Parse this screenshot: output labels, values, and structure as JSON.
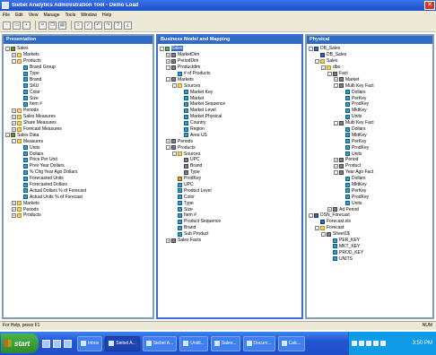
{
  "window": {
    "title": "Siebel Analytics Administration Tool - Demo Load",
    "close_glyph": "✕"
  },
  "menu": [
    "File",
    "Edit",
    "View",
    "Manage",
    "Tools",
    "Window",
    "Help"
  ],
  "toolbar": {
    "icons": [
      "new-icon",
      "open-icon",
      "save-icon",
      "cut-icon",
      "copy-icon",
      "paste-icon",
      "find-icon",
      "check-in-icon",
      "undo-icon",
      "redo-icon",
      "query-icon",
      "help-icon"
    ]
  },
  "panes": {
    "presentation": {
      "title": "Presentation",
      "rows": [
        {
          "d": 0,
          "exp": "-",
          "icon": "presentation",
          "label": "Sales"
        },
        {
          "d": 1,
          "exp": "+",
          "icon": "folder",
          "label": "Markets"
        },
        {
          "d": 1,
          "exp": "-",
          "icon": "folder",
          "label": "Products"
        },
        {
          "d": 2,
          "exp": "",
          "icon": "column",
          "label": "Brand Group"
        },
        {
          "d": 2,
          "exp": "",
          "icon": "column",
          "label": "Type"
        },
        {
          "d": 2,
          "exp": "",
          "icon": "column",
          "label": "Brand"
        },
        {
          "d": 2,
          "exp": "",
          "icon": "column",
          "label": "SKU"
        },
        {
          "d": 2,
          "exp": "",
          "icon": "column",
          "label": "Color"
        },
        {
          "d": 2,
          "exp": "",
          "icon": "column",
          "label": "Size"
        },
        {
          "d": 2,
          "exp": "",
          "icon": "column",
          "label": "Item #"
        },
        {
          "d": 1,
          "exp": "+",
          "icon": "folder",
          "label": "Periods"
        },
        {
          "d": 1,
          "exp": "+",
          "icon": "folder",
          "label": "Sales Measures"
        },
        {
          "d": 1,
          "exp": "+",
          "icon": "folder",
          "label": "Share Measures"
        },
        {
          "d": 1,
          "exp": "+",
          "icon": "folder",
          "label": "Forecast Measures"
        },
        {
          "d": 0,
          "exp": "-",
          "icon": "presentation",
          "label": "Sales Data"
        },
        {
          "d": 1,
          "exp": "-",
          "icon": "folder",
          "label": "Measures"
        },
        {
          "d": 2,
          "exp": "",
          "icon": "column",
          "label": "Units"
        },
        {
          "d": 2,
          "exp": "",
          "icon": "column",
          "label": "Dollars"
        },
        {
          "d": 2,
          "exp": "",
          "icon": "column",
          "label": "Price Per Unit"
        },
        {
          "d": 2,
          "exp": "",
          "icon": "column",
          "label": "Prev Year Dollars"
        },
        {
          "d": 2,
          "exp": "",
          "icon": "column",
          "label": "% Chg Year Ago Dollars"
        },
        {
          "d": 2,
          "exp": "",
          "icon": "column",
          "label": "Forecasted Units"
        },
        {
          "d": 2,
          "exp": "",
          "icon": "column",
          "label": "Forecasted Dollars"
        },
        {
          "d": 2,
          "exp": "",
          "icon": "column",
          "label": "Actual Dollars % of Forecast"
        },
        {
          "d": 2,
          "exp": "",
          "icon": "column",
          "label": "Actual Units % of Forecast"
        },
        {
          "d": 1,
          "exp": "+",
          "icon": "folder",
          "label": "Markets"
        },
        {
          "d": 1,
          "exp": "+",
          "icon": "folder",
          "label": "Periods"
        },
        {
          "d": 1,
          "exp": "+",
          "icon": "folder",
          "label": "Products"
        }
      ]
    },
    "business": {
      "title": "Business Model and Mapping",
      "rows": [
        {
          "d": 0,
          "exp": "-",
          "icon": "cube",
          "label": "Sales",
          "sel": true
        },
        {
          "d": 1,
          "exp": "+",
          "icon": "table",
          "label": "MarketDim"
        },
        {
          "d": 1,
          "exp": "+",
          "icon": "table",
          "label": "PeriodDim"
        },
        {
          "d": 1,
          "exp": "-",
          "icon": "table",
          "label": "Productdim"
        },
        {
          "d": 2,
          "exp": "",
          "icon": "column",
          "label": "# of Products"
        },
        {
          "d": 1,
          "exp": "-",
          "icon": "table",
          "label": "Markets"
        },
        {
          "d": 2,
          "exp": "-",
          "icon": "folder",
          "label": "Sources"
        },
        {
          "d": 3,
          "exp": "",
          "icon": "column",
          "label": "Market Key"
        },
        {
          "d": 3,
          "exp": "",
          "icon": "column",
          "label": "Market"
        },
        {
          "d": 3,
          "exp": "",
          "icon": "column",
          "label": "Market Sequence"
        },
        {
          "d": 3,
          "exp": "",
          "icon": "column",
          "label": "Market Level"
        },
        {
          "d": 3,
          "exp": "",
          "icon": "column",
          "label": "Market Physical"
        },
        {
          "d": 3,
          "exp": "",
          "icon": "column",
          "label": "Country"
        },
        {
          "d": 3,
          "exp": "",
          "icon": "column",
          "label": "Region"
        },
        {
          "d": 3,
          "exp": "",
          "icon": "column",
          "label": "Area US"
        },
        {
          "d": 1,
          "exp": "+",
          "icon": "table",
          "label": "Periods"
        },
        {
          "d": 1,
          "exp": "-",
          "icon": "table",
          "label": "Products"
        },
        {
          "d": 2,
          "exp": "-",
          "icon": "folder",
          "label": "Sources"
        },
        {
          "d": 3,
          "exp": "",
          "icon": "table",
          "label": "UPC"
        },
        {
          "d": 3,
          "exp": "",
          "icon": "table",
          "label": "Brand"
        },
        {
          "d": 3,
          "exp": "",
          "icon": "table",
          "label": "Type"
        },
        {
          "d": 2,
          "exp": "",
          "icon": "key",
          "label": "ProdKey"
        },
        {
          "d": 2,
          "exp": "",
          "icon": "column",
          "label": "UPC"
        },
        {
          "d": 2,
          "exp": "",
          "icon": "column",
          "label": "Product Level"
        },
        {
          "d": 2,
          "exp": "",
          "icon": "column",
          "label": "Color"
        },
        {
          "d": 2,
          "exp": "",
          "icon": "column",
          "label": "Type"
        },
        {
          "d": 2,
          "exp": "",
          "icon": "column",
          "label": "Size"
        },
        {
          "d": 2,
          "exp": "",
          "icon": "column",
          "label": "Item #"
        },
        {
          "d": 2,
          "exp": "",
          "icon": "column",
          "label": "Product Sequence"
        },
        {
          "d": 2,
          "exp": "",
          "icon": "column",
          "label": "Brand"
        },
        {
          "d": 2,
          "exp": "",
          "icon": "column",
          "label": "Sub Product"
        },
        {
          "d": 1,
          "exp": "+",
          "icon": "table",
          "label": "Sales Facts"
        }
      ]
    },
    "physical": {
      "title": "Physical",
      "rows": [
        {
          "d": 0,
          "exp": "-",
          "icon": "db",
          "label": "DB_Sales"
        },
        {
          "d": 1,
          "exp": "",
          "icon": "db",
          "label": "DB_Sales"
        },
        {
          "d": 1,
          "exp": "-",
          "icon": "folder",
          "label": "Sales"
        },
        {
          "d": 2,
          "exp": "-",
          "icon": "folder",
          "label": "dbo"
        },
        {
          "d": 3,
          "exp": "-",
          "icon": "table",
          "label": "Fact"
        },
        {
          "d": 4,
          "exp": "+",
          "icon": "table",
          "label": "Market"
        },
        {
          "d": 4,
          "exp": "-",
          "icon": "table",
          "label": "Multi Key Fact"
        },
        {
          "d": 5,
          "exp": "",
          "icon": "column",
          "label": "Dollars"
        },
        {
          "d": 5,
          "exp": "",
          "icon": "column",
          "label": "PerKey"
        },
        {
          "d": 5,
          "exp": "",
          "icon": "column",
          "label": "ProdKey"
        },
        {
          "d": 5,
          "exp": "",
          "icon": "column",
          "label": "MktKey"
        },
        {
          "d": 5,
          "exp": "",
          "icon": "column",
          "label": "Units"
        },
        {
          "d": 4,
          "exp": "-",
          "icon": "table",
          "label": "Multi Key Fact"
        },
        {
          "d": 5,
          "exp": "",
          "icon": "column",
          "label": "Dollars"
        },
        {
          "d": 5,
          "exp": "",
          "icon": "column",
          "label": "MktKey"
        },
        {
          "d": 5,
          "exp": "",
          "icon": "column",
          "label": "PerKey"
        },
        {
          "d": 5,
          "exp": "",
          "icon": "column",
          "label": "ProdKey"
        },
        {
          "d": 5,
          "exp": "",
          "icon": "column",
          "label": "Units"
        },
        {
          "d": 4,
          "exp": "+",
          "icon": "table",
          "label": "Period"
        },
        {
          "d": 4,
          "exp": "+",
          "icon": "table",
          "label": "Product"
        },
        {
          "d": 4,
          "exp": "-",
          "icon": "table",
          "label": "Year Ago Fact"
        },
        {
          "d": 5,
          "exp": "",
          "icon": "column",
          "label": "Dollars"
        },
        {
          "d": 5,
          "exp": "",
          "icon": "column",
          "label": "MktKey"
        },
        {
          "d": 5,
          "exp": "",
          "icon": "column",
          "label": "PerKey"
        },
        {
          "d": 5,
          "exp": "",
          "icon": "column",
          "label": "ProdKey"
        },
        {
          "d": 5,
          "exp": "",
          "icon": "column",
          "label": "Units"
        },
        {
          "d": 3,
          "exp": "+",
          "icon": "table",
          "label": "Ad Period"
        },
        {
          "d": 0,
          "exp": "-",
          "icon": "db",
          "label": "DSN_Forecast"
        },
        {
          "d": 1,
          "exp": "",
          "icon": "db",
          "label": "Forecast.xls"
        },
        {
          "d": 1,
          "exp": "-",
          "icon": "folder",
          "label": "Forecast"
        },
        {
          "d": 2,
          "exp": "-",
          "icon": "table",
          "label": "Sheet1$"
        },
        {
          "d": 3,
          "exp": "",
          "icon": "column",
          "label": "PER_KEY"
        },
        {
          "d": 3,
          "exp": "",
          "icon": "column",
          "label": "MKT_KEY"
        },
        {
          "d": 3,
          "exp": "",
          "icon": "column",
          "label": "PROD_KEY"
        },
        {
          "d": 3,
          "exp": "",
          "icon": "column",
          "label": "UNITS"
        }
      ]
    }
  },
  "status": {
    "left": "For Help, press F1",
    "right": "NUM"
  },
  "taskbar": {
    "start_label": "start",
    "tasks": [
      "Inbox",
      "Siebel A...",
      "Siebel A...",
      "Untitl...",
      "Sales...",
      "Docum...",
      "Calc..."
    ],
    "active_task_index": 1,
    "clock": "3:50 PM"
  }
}
